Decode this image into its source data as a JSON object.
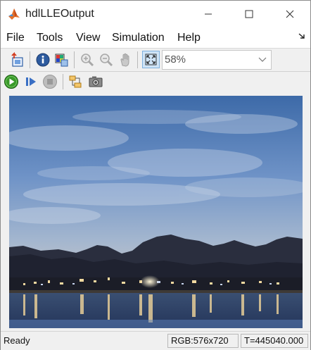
{
  "window": {
    "title": "hdlLLEOutput"
  },
  "menu": {
    "items": [
      "File",
      "Tools",
      "View",
      "Simulation",
      "Help"
    ]
  },
  "toolbar": {
    "zoom_value": "58%"
  },
  "status": {
    "state": "Ready",
    "image_info": "RGB:576x720",
    "time": "T=445040.000"
  },
  "colors": {
    "play_green": "#3a9a2a",
    "step_blue": "#3a6fc4",
    "stop_gray": "#9a9a9a",
    "fit_highlight": "#cfe4f7"
  }
}
